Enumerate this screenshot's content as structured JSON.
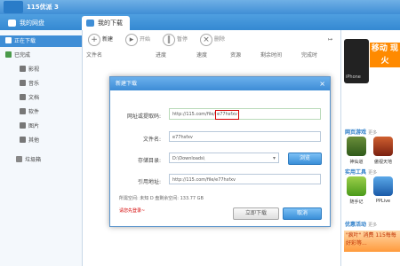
{
  "app": {
    "title": "115优派 3"
  },
  "tabs": [
    {
      "label": "我的网盘",
      "icon": "cloud-icon"
    },
    {
      "label": "我的下载",
      "icon": "download-icon"
    }
  ],
  "sidebar": {
    "items": [
      {
        "label": "正在下载",
        "icon": "download-arrow-icon"
      },
      {
        "label": "已完成",
        "icon": "check-icon"
      },
      {
        "label": "影视",
        "icon": "film-icon"
      },
      {
        "label": "音乐",
        "icon": "music-icon"
      },
      {
        "label": "文档",
        "icon": "document-icon"
      },
      {
        "label": "软件",
        "icon": "software-icon"
      },
      {
        "label": "图片",
        "icon": "image-icon"
      },
      {
        "label": "其他",
        "icon": "other-icon"
      },
      {
        "label": "垃圾箱",
        "icon": "trash-icon"
      }
    ]
  },
  "toolbar": {
    "new": "新建",
    "start": "开始",
    "pause": "暂停",
    "delete": "删除"
  },
  "columns": [
    "文件名",
    "进度",
    "速度",
    "资源",
    "剩余时间",
    "完成时"
  ],
  "dialog": {
    "title": "新建下载",
    "close": "×",
    "url_label": "网址或提取码:",
    "url_value": "http://115.com/file/",
    "url_highlight": "e77hsfxv",
    "filename_label": "文件名:",
    "filename_value": "e77hsfxv",
    "dir_label": "存储目录:",
    "dir_value": "D:\\Downloads\\",
    "browse": "浏览",
    "ref_label": "引用地址:",
    "ref_value": "http://115.com/file/e77hsfxv",
    "space_info": "所需空间: 未知  D 盘剩余空间: 133.77 GB",
    "login_hint": "请您先登录~",
    "download_now": "立即下载",
    "cancel": "取消"
  },
  "right_panel": {
    "banner_text": "移动 现火",
    "phone_label": "iPhone",
    "section_games": "网页游戏",
    "section_games_more": "更多",
    "games": [
      {
        "label": "神仙道"
      },
      {
        "label": "傲视天地"
      }
    ],
    "section_tools": "实用工具",
    "section_tools_more": "更多",
    "tools": [
      {
        "label": "随手记"
      },
      {
        "label": "PPLive"
      }
    ],
    "section_promo": "优惠活动",
    "section_promo_more": "更多",
    "promo_text": "\"疯叶\" 消费 115每每好彩等..."
  },
  "colors": {
    "accent": "#3f8ed6",
    "highlight_border": "#d40000"
  }
}
